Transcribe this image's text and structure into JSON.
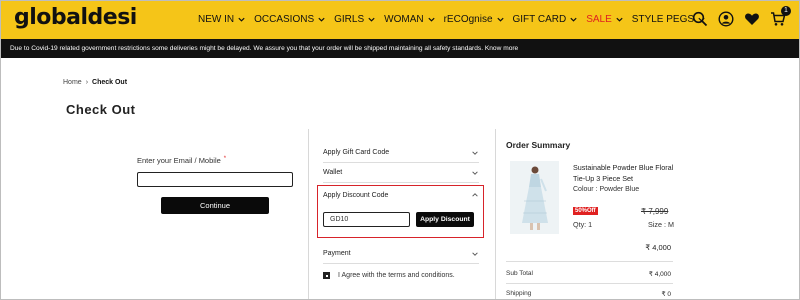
{
  "brand": {
    "logo_text": "globaldesi"
  },
  "nav": {
    "items": [
      {
        "label": "NEW IN",
        "has_dropdown": true
      },
      {
        "label": "OCCASIONS",
        "has_dropdown": true
      },
      {
        "label": "GIRLS",
        "has_dropdown": true
      },
      {
        "label": "WOMAN",
        "has_dropdown": true
      },
      {
        "label": "rECOgnise",
        "has_dropdown": true
      },
      {
        "label": "GIFT CARD",
        "has_dropdown": true
      },
      {
        "label": "SALE",
        "has_dropdown": true,
        "color": "#e02020"
      },
      {
        "label": "STYLE PEGS",
        "has_dropdown": true
      }
    ],
    "icons": [
      "search-icon",
      "user-icon",
      "heart-icon",
      "cart-icon"
    ],
    "cart_count": "1"
  },
  "notice": {
    "text": "Due to Covid-19 related government restrictions some deliveries might be delayed. We assure you that your order will be shipped maintaining all safety standards. Know more"
  },
  "breadcrumb": {
    "home": "Home",
    "current": "Check Out"
  },
  "page_title": "Check Out",
  "login": {
    "label": "Enter your Email / Mobile",
    "required_mark": "*",
    "email_value": "",
    "continue_label": "Continue"
  },
  "checkout_options": {
    "gift_card": "Apply Gift Card Code",
    "wallet": "Wallet",
    "discount": {
      "title": "Apply Discount Code",
      "code_value": "GD10",
      "button_label": "Apply Discount",
      "highlight_color": "#d7232a"
    },
    "payment": "Payment",
    "terms_label": "I Agree with the terms and conditions.",
    "terms_checked": true
  },
  "order_summary": {
    "title": "Order Summary",
    "product": {
      "name": "Sustainable Powder Blue Floral Tie-Up 3 Piece Set",
      "colour_label": "Colour :",
      "colour_value": "Powder Blue",
      "discount_badge": "50%Off",
      "mrp": "₹ 7,999",
      "qty": "Qty: 1",
      "size": "Size : M",
      "price": "₹ 4,000"
    },
    "sub_total_label": "Sub Total",
    "sub_total_value": "₹ 4,000",
    "shipping_label": "Shipping",
    "shipping_value": "₹ 0"
  },
  "colors": {
    "header_bg": "#f5c518",
    "notice_bg": "#111111",
    "button_bg": "#0a0a0a",
    "sale": "#e02020"
  }
}
